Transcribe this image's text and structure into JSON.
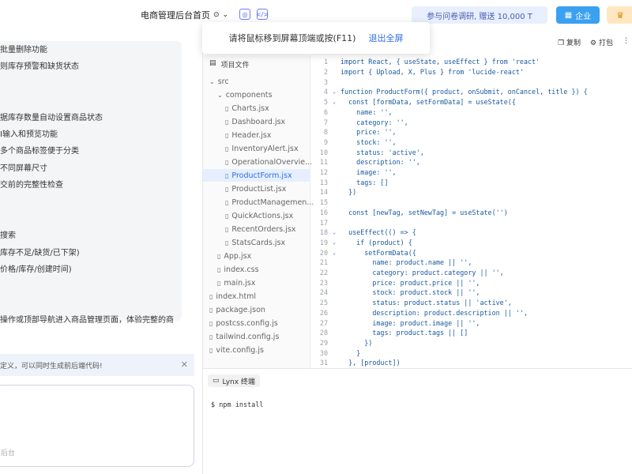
{
  "topbar": {
    "title": "电商管理后台首页",
    "promo": "参与问卷调研, 赠送 10,000 T",
    "enterprise": "企业"
  },
  "toast": {
    "message": "请将鼠标移到屏幕顶端或按(F11)",
    "exit": "退出全屏"
  },
  "left_panel": {
    "lines": [
      "批量删除功能",
      "则库存预警和缺货状态",
      "",
      "",
      "据库存数量自动设置商品状态",
      "Ⅰ输入和预览功能",
      "多个商品标签便于分类",
      "不同屏幕尺寸",
      "交前的完整性检查",
      "",
      "",
      "搜索",
      "库存不足/缺货/已下架)",
      "价格/库存/创建时间)",
      "",
      "",
      "操作或顶部导航进入商品管理页面，体验完整的商"
    ],
    "hint": "定义，可以同时生成前后端代码!",
    "input_placeholder": "后台"
  },
  "editor": {
    "actions": [
      "复制",
      "打包"
    ],
    "filetree_title": "项目文件",
    "files": [
      {
        "name": "src",
        "indent": 1,
        "type": "folder"
      },
      {
        "name": "components",
        "indent": 2,
        "type": "folder"
      },
      {
        "name": "Charts.jsx",
        "indent": 3,
        "type": "file"
      },
      {
        "name": "Dashboard.jsx",
        "indent": 3,
        "type": "file"
      },
      {
        "name": "Header.jsx",
        "indent": 3,
        "type": "file"
      },
      {
        "name": "InventoryAlert.jsx",
        "indent": 3,
        "type": "file"
      },
      {
        "name": "OperationalOvervie...",
        "indent": 3,
        "type": "file"
      },
      {
        "name": "ProductForm.jsx",
        "indent": 3,
        "type": "file",
        "active": true
      },
      {
        "name": "ProductList.jsx",
        "indent": 3,
        "type": "file"
      },
      {
        "name": "ProductManagemen...",
        "indent": 3,
        "type": "file"
      },
      {
        "name": "QuickActions.jsx",
        "indent": 3,
        "type": "file"
      },
      {
        "name": "RecentOrders.jsx",
        "indent": 3,
        "type": "file"
      },
      {
        "name": "StatsCards.jsx",
        "indent": 3,
        "type": "file"
      },
      {
        "name": "App.jsx",
        "indent": 2,
        "type": "file"
      },
      {
        "name": "index.css",
        "indent": 2,
        "type": "file"
      },
      {
        "name": "main.jsx",
        "indent": 2,
        "type": "file"
      },
      {
        "name": "index.html",
        "indent": 1,
        "type": "file"
      },
      {
        "name": "package.json",
        "indent": 1,
        "type": "file"
      },
      {
        "name": "postcss.config.js",
        "indent": 1,
        "type": "file"
      },
      {
        "name": "tailwind.config.js",
        "indent": 1,
        "type": "file"
      },
      {
        "name": "vite.config.js",
        "indent": 1,
        "type": "file"
      }
    ],
    "code": [
      {
        "n": "1",
        "fold": false,
        "text": "import React, { useState, useEffect } from 'react'"
      },
      {
        "n": "2",
        "fold": false,
        "text": "import { Upload, X, Plus } from 'lucide-react'"
      },
      {
        "n": "3",
        "fold": false,
        "text": ""
      },
      {
        "n": "4",
        "fold": true,
        "text": "function ProductForm({ product, onSubmit, onCancel, title }) {"
      },
      {
        "n": "5",
        "fold": true,
        "text": "  const [formData, setFormData] = useState({"
      },
      {
        "n": "6",
        "fold": false,
        "text": "    name: '',"
      },
      {
        "n": "7",
        "fold": false,
        "text": "    category: '',"
      },
      {
        "n": "8",
        "fold": false,
        "text": "    price: '',"
      },
      {
        "n": "9",
        "fold": false,
        "text": "    stock: '',"
      },
      {
        "n": "10",
        "fold": false,
        "text": "    status: 'active',"
      },
      {
        "n": "11",
        "fold": false,
        "text": "    description: '',"
      },
      {
        "n": "12",
        "fold": false,
        "text": "    image: '',"
      },
      {
        "n": "13",
        "fold": false,
        "text": "    tags: []"
      },
      {
        "n": "14",
        "fold": false,
        "text": "  })"
      },
      {
        "n": "15",
        "fold": false,
        "text": ""
      },
      {
        "n": "16",
        "fold": false,
        "text": "  const [newTag, setNewTag] = useState('')"
      },
      {
        "n": "17",
        "fold": false,
        "text": ""
      },
      {
        "n": "18",
        "fold": true,
        "text": "  useEffect(() => {"
      },
      {
        "n": "19",
        "fold": true,
        "text": "    if (product) {"
      },
      {
        "n": "20",
        "fold": true,
        "text": "      setFormData({"
      },
      {
        "n": "21",
        "fold": false,
        "text": "        name: product.name || '',"
      },
      {
        "n": "22",
        "fold": false,
        "text": "        category: product.category || '',"
      },
      {
        "n": "23",
        "fold": false,
        "text": "        price: product.price || '',"
      },
      {
        "n": "24",
        "fold": false,
        "text": "        stock: product.stock || '',"
      },
      {
        "n": "25",
        "fold": false,
        "text": "        status: product.status || 'active',"
      },
      {
        "n": "26",
        "fold": false,
        "text": "        description: product.description || '',"
      },
      {
        "n": "27",
        "fold": false,
        "text": "        image: product.image || '',"
      },
      {
        "n": "28",
        "fold": false,
        "text": "        tags: product.tags || []"
      },
      {
        "n": "29",
        "fold": false,
        "text": "      })"
      },
      {
        "n": "30",
        "fold": false,
        "text": "    }"
      },
      {
        "n": "31",
        "fold": false,
        "text": "  }, [product])"
      }
    ],
    "terminal_tab": "Lynx 终端",
    "terminal_line": "$ npm install"
  }
}
